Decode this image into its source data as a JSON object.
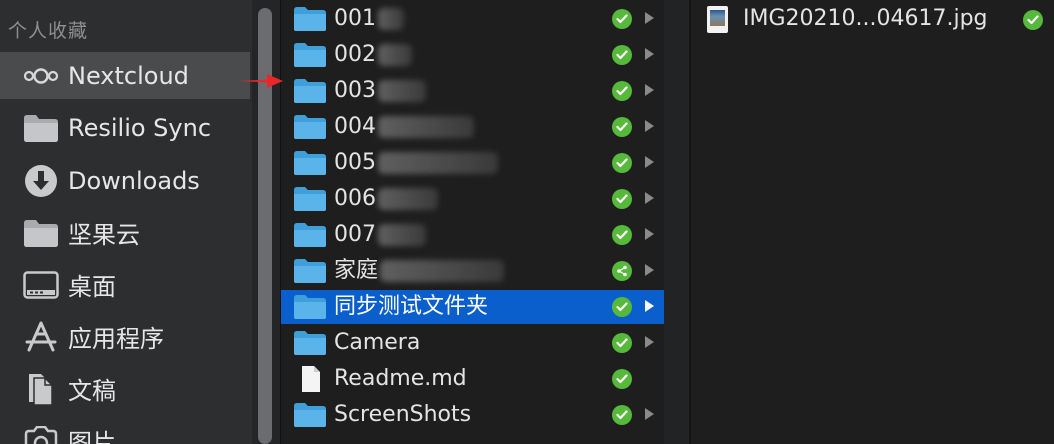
{
  "sidebar": {
    "section_title": "个人收藏",
    "items": [
      {
        "label": "Nextcloud",
        "icon": "nextcloud-icon"
      },
      {
        "label": "Resilio Sync",
        "icon": "folder-icon"
      },
      {
        "label": "Downloads",
        "icon": "download-icon"
      },
      {
        "label": "坚果云",
        "icon": "folder-icon"
      },
      {
        "label": "桌面",
        "icon": "desktop-icon"
      },
      {
        "label": "应用程序",
        "icon": "applications-icon"
      },
      {
        "label": "文稿",
        "icon": "documents-icon"
      },
      {
        "label": "图片",
        "icon": "camera-icon"
      }
    ],
    "selected": "Nextcloud"
  },
  "column1": {
    "rows": [
      {
        "label": "001",
        "type": "folder",
        "status": "synced"
      },
      {
        "label": "002",
        "type": "folder",
        "status": "synced"
      },
      {
        "label": "003",
        "type": "folder",
        "status": "synced"
      },
      {
        "label": "004",
        "type": "folder",
        "status": "synced"
      },
      {
        "label": "005",
        "type": "folder",
        "status": "synced"
      },
      {
        "label": "006",
        "type": "folder",
        "status": "synced"
      },
      {
        "label": "007",
        "type": "folder",
        "status": "synced"
      },
      {
        "label": "家庭",
        "type": "folder",
        "status": "shared"
      },
      {
        "label": "同步测试文件夹",
        "type": "folder",
        "status": "synced",
        "selected": true
      },
      {
        "label": "Camera",
        "type": "folder",
        "status": "synced"
      },
      {
        "label": "Readme.md",
        "type": "file",
        "status": "synced"
      },
      {
        "label": "ScreenShots",
        "type": "folder",
        "status": "synced"
      }
    ]
  },
  "column2": {
    "file": {
      "label": "IMG20210...04617.jpg",
      "status": "synced",
      "icon": "image-thumbnail-icon"
    }
  },
  "colors": {
    "sidebar_bg": "#2d2e30",
    "sidebar_selected": "#4a4b4d",
    "selection_blue": "#0b5fcc",
    "folder_blue": "#5ab4ea",
    "sync_green": "#56b93b",
    "annotation_red": "#e8262b"
  }
}
